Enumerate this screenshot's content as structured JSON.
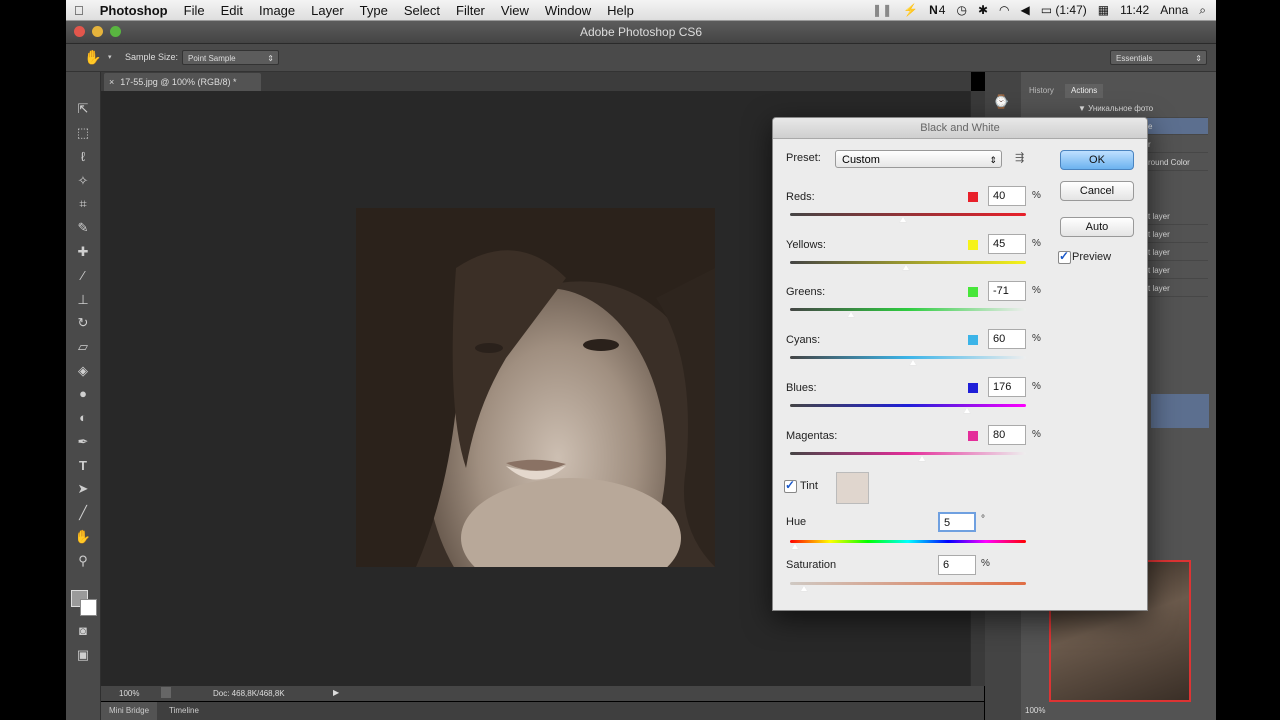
{
  "menubar": {
    "apple_icon": "apple-icon",
    "app_name": "Photoshop",
    "items": [
      "File",
      "Edit",
      "Image",
      "Layer",
      "Type",
      "Select",
      "Filter",
      "View",
      "Window",
      "Help"
    ],
    "battery": "(1:47)",
    "clock": "11:42",
    "user": "Anna",
    "notification_count": "4"
  },
  "window": {
    "title": "Adobe Photoshop CS6"
  },
  "options": {
    "sample_size_label": "Sample Size:",
    "sample_size_value": "Point Sample",
    "workspace": "Essentials"
  },
  "document": {
    "tab_label": "17-55.jpg @ 100% (RGB/8) *"
  },
  "status": {
    "zoom": "100%",
    "doc_size": "Doc: 468,8K/468,8K"
  },
  "bottom_tabs": [
    "Mini Bridge",
    "Timeline"
  ],
  "right_panel": {
    "tabs": [
      "History",
      "Actions"
    ],
    "action_set": "Уникальное фото",
    "rows": [
      "е",
      "r",
      "round Color",
      "t layer",
      "t layer",
      "t layer",
      "t layer",
      "t layer"
    ],
    "zoom": "100%"
  },
  "dialog": {
    "title": "Black and White",
    "preset_label": "Preset:",
    "preset_value": "Custom",
    "buttons": {
      "ok": "OK",
      "cancel": "Cancel",
      "auto": "Auto"
    },
    "preview_label": "Preview",
    "preview_checked": true,
    "sliders": [
      {
        "label": "Reds:",
        "value": "40",
        "unit": "%",
        "swatch": "#e8202a",
        "position": 0.48
      },
      {
        "label": "Yellows:",
        "value": "45",
        "unit": "%",
        "swatch": "#f6f31a",
        "position": 0.49
      },
      {
        "label": "Greens:",
        "value": "-71",
        "unit": "%",
        "swatch": "#47e63a",
        "position": 0.26
      },
      {
        "label": "Cyans:",
        "value": "60",
        "unit": "%",
        "swatch": "#3cb4e8",
        "position": 0.52
      },
      {
        "label": "Blues:",
        "value": "176",
        "unit": "%",
        "swatch": "#1f1fd8",
        "position": 0.75
      },
      {
        "label": "Magentas:",
        "value": "80",
        "unit": "%",
        "swatch": "#e42d9a",
        "position": 0.56
      }
    ],
    "tint_label": "Tint",
    "tint_checked": true,
    "tint_color": "#e0d6ce",
    "hue": {
      "label": "Hue",
      "value": "5",
      "unit": "°",
      "position": 0.02
    },
    "saturation": {
      "label": "Saturation",
      "value": "6",
      "unit": "%",
      "position": 0.06
    }
  }
}
